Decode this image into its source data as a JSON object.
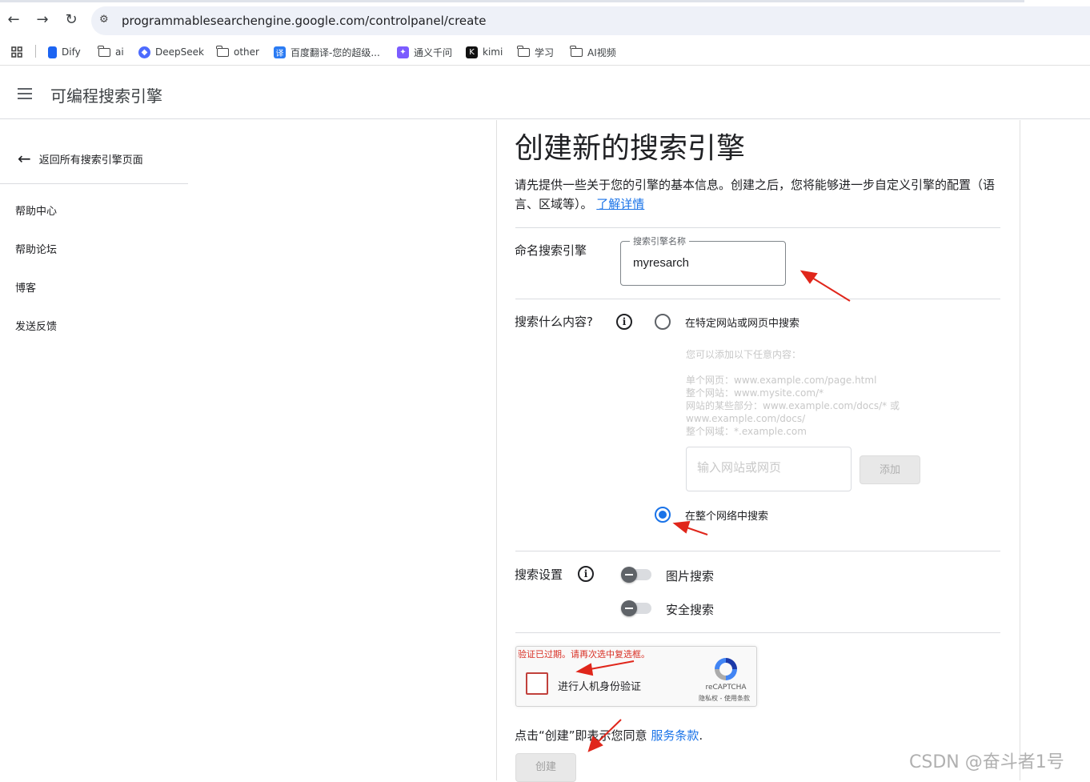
{
  "browser": {
    "url": "programmablesearchengine.google.com/controlpanel/create",
    "bookmarks": [
      {
        "label": "Dify",
        "icon": "dify-icon",
        "color": "#1c64f2"
      },
      {
        "label": "ai",
        "icon": "folder-icon"
      },
      {
        "label": "DeepSeek",
        "icon": "deepseek-icon",
        "color": "#4d6bfe"
      },
      {
        "label": "other",
        "icon": "folder-icon"
      },
      {
        "label": "百度翻译-您的超级...",
        "icon": "baidu-translate-icon",
        "color": "#2b7bf3"
      },
      {
        "label": "通义千问",
        "icon": "tongyi-icon",
        "color": "#7b5cff"
      },
      {
        "label": "kimi",
        "icon": "kimi-icon",
        "color": "#111111"
      },
      {
        "label": "学习",
        "icon": "folder-icon"
      },
      {
        "label": "AI视频",
        "icon": "folder-icon"
      }
    ]
  },
  "header": {
    "title": "可编程搜索引擎"
  },
  "sidebar": {
    "back_label": "返回所有搜索引擎页面",
    "items": [
      {
        "label": "帮助中心"
      },
      {
        "label": "帮助论坛"
      },
      {
        "label": "博客"
      },
      {
        "label": "发送反馈"
      }
    ]
  },
  "main": {
    "title": "创建新的搜索引擎",
    "intro": "请先提供一些关于您的引擎的基本信息。创建之后，您将能够进一步自定义引擎的配置（语言、区域等）。",
    "learn_more": "了解详情",
    "name_section": {
      "label": "命名搜索引擎",
      "field_label": "搜索引擎名称",
      "field_value": "myresarch"
    },
    "what_section": {
      "label": "搜索什么内容?",
      "option_specific": "在特定网站或网页中搜索",
      "hint_title": "您可以添加以下任意内容：",
      "hint_lines": [
        "单个网页：www.example.com/page.html",
        "整个网站：www.mysite.com/*",
        "网站的某些部分：www.example.com/docs/* 或",
        "www.example.com/docs/",
        "整个网域：*.example.com"
      ],
      "site_placeholder": "输入网站或网页",
      "add_button": "添加",
      "option_entire_web": "在整个网络中搜索",
      "selected": "entire_web"
    },
    "settings_section": {
      "label": "搜索设置",
      "image_search": {
        "label": "图片搜索",
        "enabled": false
      },
      "safe_search": {
        "label": "安全搜索",
        "enabled": false
      }
    },
    "recaptcha": {
      "error": "验证已过期。请再次选中复选框。",
      "label": "进行人机身份验证",
      "brand": "reCAPTCHA",
      "terms": "隐私权 - 使用条款"
    },
    "terms_prefix": "点击“创建”即表示您同意",
    "terms_link": "服务条款",
    "terms_suffix": ".",
    "create_button": "创建"
  },
  "watermark": "CSDN @奋斗者1号",
  "colors": {
    "accent": "#1a73e8",
    "annotation_arrow": "#e0261b",
    "error": "#d93025"
  }
}
